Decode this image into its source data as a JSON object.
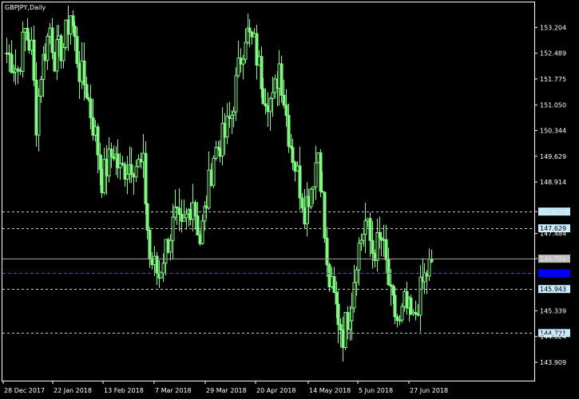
{
  "window": {
    "symbol_label": "GBPJPY,Daily"
  },
  "colors": {
    "background": "#000000",
    "frame": "#ffffff",
    "axis_text": "#ffffff",
    "candle": "#7cfc7c",
    "level_line": "#c8c8c8",
    "level_tag_bg": "#c8ecff",
    "level_tag_text": "#000000",
    "current_tag_bg": "#c0c0c0",
    "bid_line": "#3050ff",
    "bid_tag_bg": "#0000ff",
    "bid_tag_text": "#0000ff"
  },
  "chart_data": {
    "type": "candlestick",
    "symbol": "GBPJPY",
    "timeframe": "Daily",
    "ylim": [
      143.4,
      153.9
    ],
    "y_ticks": [
      "153.204",
      "152.489",
      "151.775",
      "151.050",
      "150.344",
      "149.629",
      "148.914",
      "148.093",
      "147.484",
      "146.786",
      "145.339",
      "144.624",
      "143.909"
    ],
    "x_ticks": [
      "28 Dec 2017",
      "22 Jan 2018",
      "13 Feb 2018",
      "7 Mar 2018",
      "29 Mar 2018",
      "20 Apr 2018",
      "14 May 2018",
      "5 Jun 2018",
      "27 Jun 2018"
    ],
    "levels": [
      {
        "value": 148.093,
        "label": "148.093",
        "style": "dashed"
      },
      {
        "value": 147.629,
        "label": "147.629",
        "style": "dashed"
      },
      {
        "value": 145.943,
        "label": "145.943",
        "style": "dashed"
      },
      {
        "value": 144.721,
        "label": "144.721",
        "style": "dashed"
      }
    ],
    "current_price": {
      "value": 146.786,
      "label": "146.786"
    },
    "bid_price": {
      "value": 146.4
    },
    "close_path": [
      {
        "date": "2017-12-28",
        "close": 152.5
      },
      {
        "date": "2018-01-02",
        "close": 152.0
      },
      {
        "date": "2018-01-05",
        "close": 153.1
      },
      {
        "date": "2018-01-08",
        "close": 152.6
      },
      {
        "date": "2018-01-10",
        "close": 150.6
      },
      {
        "date": "2018-01-12",
        "close": 152.0
      },
      {
        "date": "2018-01-16",
        "close": 153.2
      },
      {
        "date": "2018-01-18",
        "close": 152.4
      },
      {
        "date": "2018-01-22",
        "close": 152.7
      },
      {
        "date": "2018-01-25",
        "close": 153.6
      },
      {
        "date": "2018-01-29",
        "close": 152.0
      },
      {
        "date": "2018-02-01",
        "close": 151.5
      },
      {
        "date": "2018-02-05",
        "close": 150.2
      },
      {
        "date": "2018-02-08",
        "close": 149.0
      },
      {
        "date": "2018-02-13",
        "close": 149.8
      },
      {
        "date": "2018-02-16",
        "close": 149.2
      },
      {
        "date": "2018-02-21",
        "close": 149.5
      },
      {
        "date": "2018-02-26",
        "close": 149.3
      },
      {
        "date": "2018-03-01",
        "close": 146.8
      },
      {
        "date": "2018-03-05",
        "close": 146.3
      },
      {
        "date": "2018-03-07",
        "close": 146.9
      },
      {
        "date": "2018-03-12",
        "close": 147.9
      },
      {
        "date": "2018-03-15",
        "close": 147.5
      },
      {
        "date": "2018-03-20",
        "close": 148.5
      },
      {
        "date": "2018-03-23",
        "close": 147.3
      },
      {
        "date": "2018-03-26",
        "close": 148.4
      },
      {
        "date": "2018-03-29",
        "close": 149.7
      },
      {
        "date": "2018-04-03",
        "close": 150.2
      },
      {
        "date": "2018-04-06",
        "close": 150.8
      },
      {
        "date": "2018-04-10",
        "close": 152.4
      },
      {
        "date": "2018-04-12",
        "close": 153.1
      },
      {
        "date": "2018-04-16",
        "close": 152.7
      },
      {
        "date": "2018-04-20",
        "close": 151.5
      },
      {
        "date": "2018-04-24",
        "close": 151.1
      },
      {
        "date": "2018-04-27",
        "close": 152.2
      },
      {
        "date": "2018-05-01",
        "close": 150.3
      },
      {
        "date": "2018-05-04",
        "close": 149.4
      },
      {
        "date": "2018-05-08",
        "close": 148.2
      },
      {
        "date": "2018-05-11",
        "close": 148.8
      },
      {
        "date": "2018-05-14",
        "close": 149.8
      },
      {
        "date": "2018-05-16",
        "close": 148.4
      },
      {
        "date": "2018-05-18",
        "close": 146.4
      },
      {
        "date": "2018-05-22",
        "close": 145.4
      },
      {
        "date": "2018-05-25",
        "close": 144.7
      },
      {
        "date": "2018-05-29",
        "close": 145.7
      },
      {
        "date": "2018-05-31",
        "close": 146.9
      },
      {
        "date": "2018-06-04",
        "close": 147.8
      },
      {
        "date": "2018-06-07",
        "close": 147.0
      },
      {
        "date": "2018-06-11",
        "close": 147.3
      },
      {
        "date": "2018-06-13",
        "close": 146.6
      },
      {
        "date": "2018-06-15",
        "close": 145.6
      },
      {
        "date": "2018-06-19",
        "close": 144.9
      },
      {
        "date": "2018-06-21",
        "close": 145.5
      },
      {
        "date": "2018-06-25",
        "close": 145.0
      },
      {
        "date": "2018-06-27",
        "close": 145.6
      },
      {
        "date": "2018-06-29",
        "close": 146.1
      },
      {
        "date": "2018-07-03",
        "close": 146.7
      }
    ]
  }
}
